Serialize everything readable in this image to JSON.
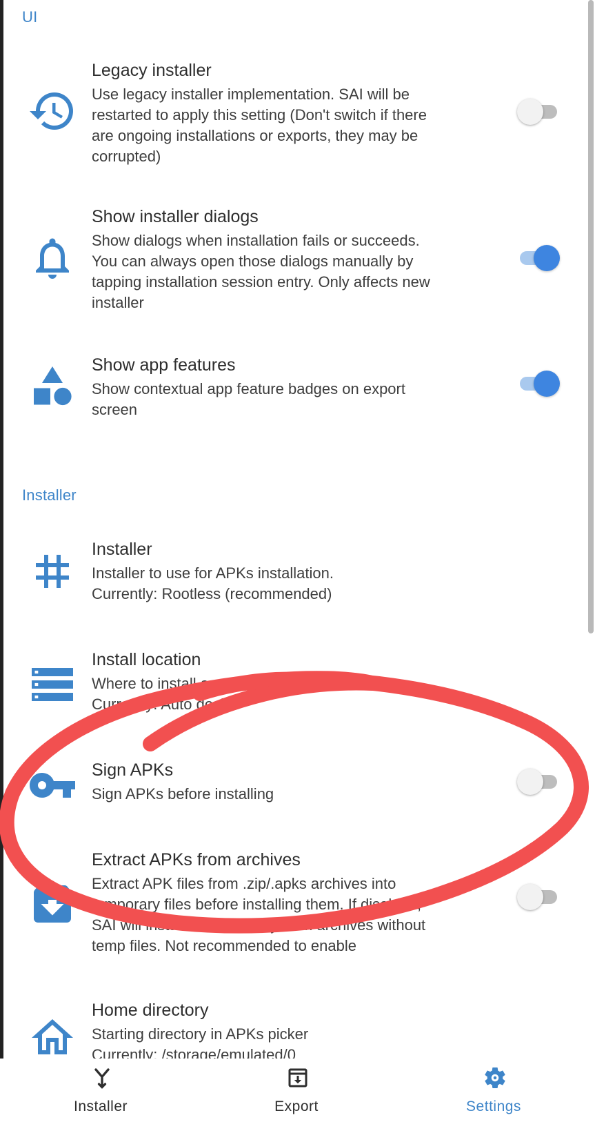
{
  "sections": {
    "ui": "UI",
    "installer": "Installer"
  },
  "items": [
    {
      "title": "Legacy installer",
      "summary": [
        "Use legacy installer implementation. SAI will be",
        "restarted to apply this setting (Don't switch if there",
        "are ongoing installations or exports, they may be",
        "corrupted)"
      ],
      "icon": "history-icon",
      "switch": "off"
    },
    {
      "title": "Show installer dialogs",
      "summary": [
        "Show dialogs when installation fails or succeeds.",
        "You can always open those dialogs manually by",
        "tapping installation session entry. Only affects new",
        "installer"
      ],
      "icon": "bell-icon",
      "switch": "on"
    },
    {
      "title": "Show app features",
      "summary": [
        "Show contextual app feature badges on export",
        "screen"
      ],
      "icon": "shapes-icon",
      "switch": "on"
    },
    {
      "title": "Installer",
      "summary": [
        "Installer to use for APKs installation.",
        "Currently: Rootless (recommended)"
      ],
      "icon": "hash-icon"
    },
    {
      "title": "Install location",
      "summary": [
        "Where to install apps",
        "Currently: Auto decide"
      ],
      "icon": "storage-icon"
    },
    {
      "title": "Sign APKs",
      "summary": [
        "Sign APKs before installing"
      ],
      "icon": "key-icon",
      "switch": "off"
    },
    {
      "title": "Extract APKs from archives",
      "summary": [
        "Extract APK files from .zip/.apks archives into",
        "temporary files before installing them. If disabled,",
        "SAI will install APKs directly from archives without",
        "temp files. Not recommended to enable"
      ],
      "icon": "archive-icon",
      "switch": "off"
    },
    {
      "title": "Home directory",
      "summary": [
        "Starting directory in APKs picker",
        "Currently: /storage/emulated/0"
      ],
      "icon": "home-icon"
    }
  ],
  "nav": [
    {
      "label": "Installer",
      "icon": "installer-nav-icon"
    },
    {
      "label": "Export",
      "icon": "export-nav-icon"
    },
    {
      "label": "Settings",
      "icon": "settings-nav-icon",
      "active": true
    }
  ],
  "colors": {
    "accent": "#3e85c9",
    "switch_on": "#3e85e0",
    "annotation": "#f25050"
  }
}
